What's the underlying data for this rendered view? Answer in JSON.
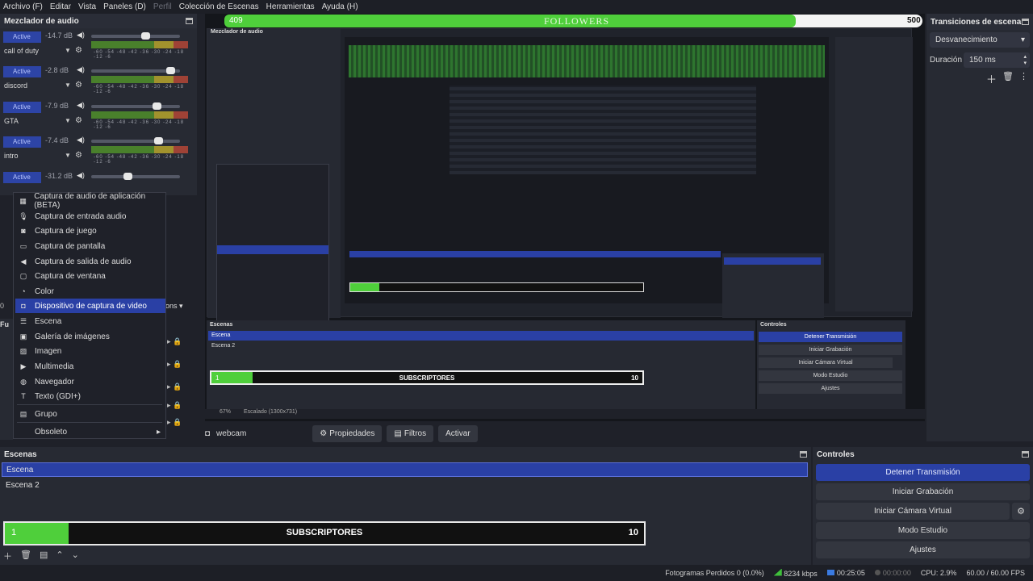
{
  "menu": [
    "Archivo (F)",
    "Editar",
    "Vista",
    "Paneles (D)",
    "Perfil",
    "Colección de Escenas",
    "Herramientas",
    "Ayuda (H)"
  ],
  "mixer": {
    "title": "Mezclador de audio",
    "scale": "-60 -54 -48 -42 -36 -30 -24 -18 -12 -6",
    "channels": [
      {
        "badge": "Active",
        "db": "-14.7 dB",
        "name": "call of duty",
        "level": 0.62
      },
      {
        "badge": "Active",
        "db": "-2.8 dB",
        "name": "discord",
        "level": 0.93
      },
      {
        "badge": "Active",
        "db": "-7.9 dB",
        "name": "GTA",
        "level": 0.76
      },
      {
        "badge": "Active",
        "db": "-7.4 dB",
        "name": "intro",
        "level": 0.78
      },
      {
        "badge": "Active",
        "db": "-31.2 dB",
        "name": "",
        "level": 0.4
      }
    ]
  },
  "context_menu": {
    "items": [
      {
        "icon": "app-audio-capture-icon",
        "glyph": "▦",
        "label": "Captura de audio de aplicación (BETA)"
      },
      {
        "icon": "microphone-icon",
        "glyph": "🎙",
        "label": "Captura de entrada audio"
      },
      {
        "icon": "gamepad-icon",
        "glyph": "◙",
        "label": "Captura de juego"
      },
      {
        "icon": "monitor-icon",
        "glyph": "▭",
        "label": "Captura de pantalla"
      },
      {
        "icon": "speaker-icon",
        "glyph": "◀",
        "label": "Captura de salida de audio"
      },
      {
        "icon": "window-icon",
        "glyph": "▢",
        "label": "Captura de ventana"
      },
      {
        "icon": "palette-icon",
        "glyph": "◔",
        "label": "Color"
      },
      {
        "icon": "camera-icon",
        "glyph": "◘",
        "label": "Dispositivo de captura de video"
      },
      {
        "icon": "list-icon",
        "glyph": "☰",
        "label": "Escena"
      },
      {
        "icon": "gallery-icon",
        "glyph": "▣",
        "label": "Galería de imágenes"
      },
      {
        "icon": "image-icon",
        "glyph": "▨",
        "label": "Imagen"
      },
      {
        "icon": "play-icon",
        "glyph": "▶",
        "label": "Multimedia"
      },
      {
        "icon": "globe-icon",
        "glyph": "◍",
        "label": "Navegador"
      },
      {
        "icon": "text-icon",
        "glyph": "T",
        "label": "Texto (GDI+)"
      },
      {
        "icon": "folder-icon",
        "glyph": "▤",
        "label": "Grupo"
      },
      {
        "icon": "",
        "glyph": "",
        "label": "Obsoleto"
      }
    ],
    "selected_index": 7
  },
  "preview": {
    "followers_label": "FOLLOWERS",
    "followers_current": "409",
    "followers_goal": "500",
    "source_name": "webcam",
    "buttons": {
      "properties": "Propiedades",
      "filters": "Filtros",
      "activate": "Activar"
    },
    "zoom": "67%",
    "scale_label": "Escalado (1300x731)"
  },
  "transitions": {
    "title": "Transiciones de escena",
    "selected": "Desvanecimiento",
    "duration_label": "Duración",
    "duration_value": "150 ms"
  },
  "scenes": {
    "title": "Escenas",
    "items": [
      "Escena",
      "Escena 2"
    ],
    "selected_index": 0,
    "subs_current": "1",
    "subs_label": "SUBSCRIPTORES",
    "subs_goal": "10",
    "subs_progress": 0.1
  },
  "controls": {
    "title": "Controles",
    "stop_stream": "Detener Transmisión",
    "start_recording": "Iniciar Grabación",
    "start_virtual_cam": "Iniciar Cámara Virtual",
    "studio_mode": "Modo Estudio",
    "settings": "Ajustes"
  },
  "status": {
    "dropped_frames": "Fotogramas Perdidos 0 (0.0%)",
    "bitrate": "8234 kbps",
    "stream_time": "00:25:05",
    "rec_time": "00:00:00",
    "cpu": "CPU: 2.9%",
    "fps": "60.00 / 60.00 FPS"
  },
  "colors": {
    "accent": "#2a40a5",
    "progress": "#4fcf3b",
    "bg": "#1f2129"
  }
}
